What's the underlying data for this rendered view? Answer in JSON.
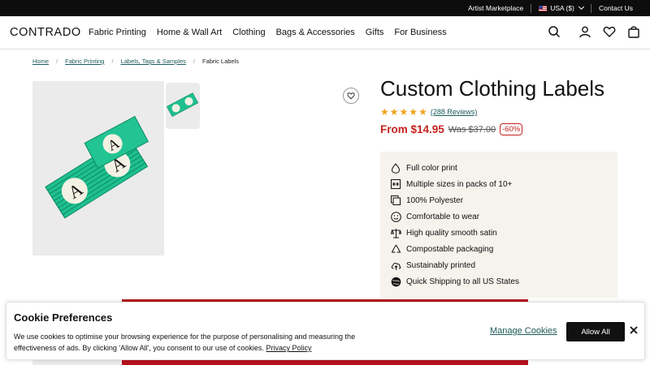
{
  "topbar": {
    "artist_marketplace": "Artist Marketplace",
    "region": "USA ($)",
    "contact": "Contact Us"
  },
  "nav": {
    "logo": "CONTRADO",
    "menu": [
      "Fabric Printing",
      "Home & Wall Art",
      "Clothing",
      "Bags & Accessories",
      "Gifts",
      "For Business"
    ],
    "icons": [
      "search-icon",
      "account-icon",
      "heart-icon",
      "bag-icon"
    ]
  },
  "breadcrumb": {
    "items": [
      "Home",
      "Fabric Printing",
      "Labels, Tags & Samples"
    ],
    "current": "Fabric Labels"
  },
  "product": {
    "title": "Custom Clothing Labels",
    "stars": 5,
    "reviews": "(288 Reviews)",
    "price": "From $14.95",
    "was_price": "Was $37.00",
    "discount": "-60%",
    "features": [
      {
        "icon": "drop-icon",
        "label": "Full color print"
      },
      {
        "icon": "resize-icon",
        "label": "Multiple sizes in packs of 10+"
      },
      {
        "icon": "layers-icon",
        "label": "100% Polyester"
      },
      {
        "icon": "smile-icon",
        "label": "Comfortable to wear"
      },
      {
        "icon": "scales-icon",
        "label": "High quality smooth satin"
      },
      {
        "icon": "recycle-icon",
        "label": "Compostable packaging"
      },
      {
        "icon": "cloud-upload-icon",
        "label": "Sustainably printed"
      },
      {
        "icon": "globe-icon",
        "label": "Quick Shipping to all US States"
      }
    ]
  },
  "cookie": {
    "title": "Cookie Preferences",
    "text": "We use cookies to optimise your browsing experience for the purpose of personalising and measuring the effectiveness of ads. By clicking 'Allow All', you consent to our use of cookies.",
    "privacy_link": "Privacy Policy",
    "manage": "Manage Cookies",
    "allow_all": "Allow All"
  },
  "colors": {
    "accent_link": "#1c5a5a",
    "price_red": "#c5221f",
    "star": "#f0a31c",
    "feature_bg": "#f6f2ec",
    "banner_red": "#b5121b",
    "label_green": "#1fbf8f"
  }
}
